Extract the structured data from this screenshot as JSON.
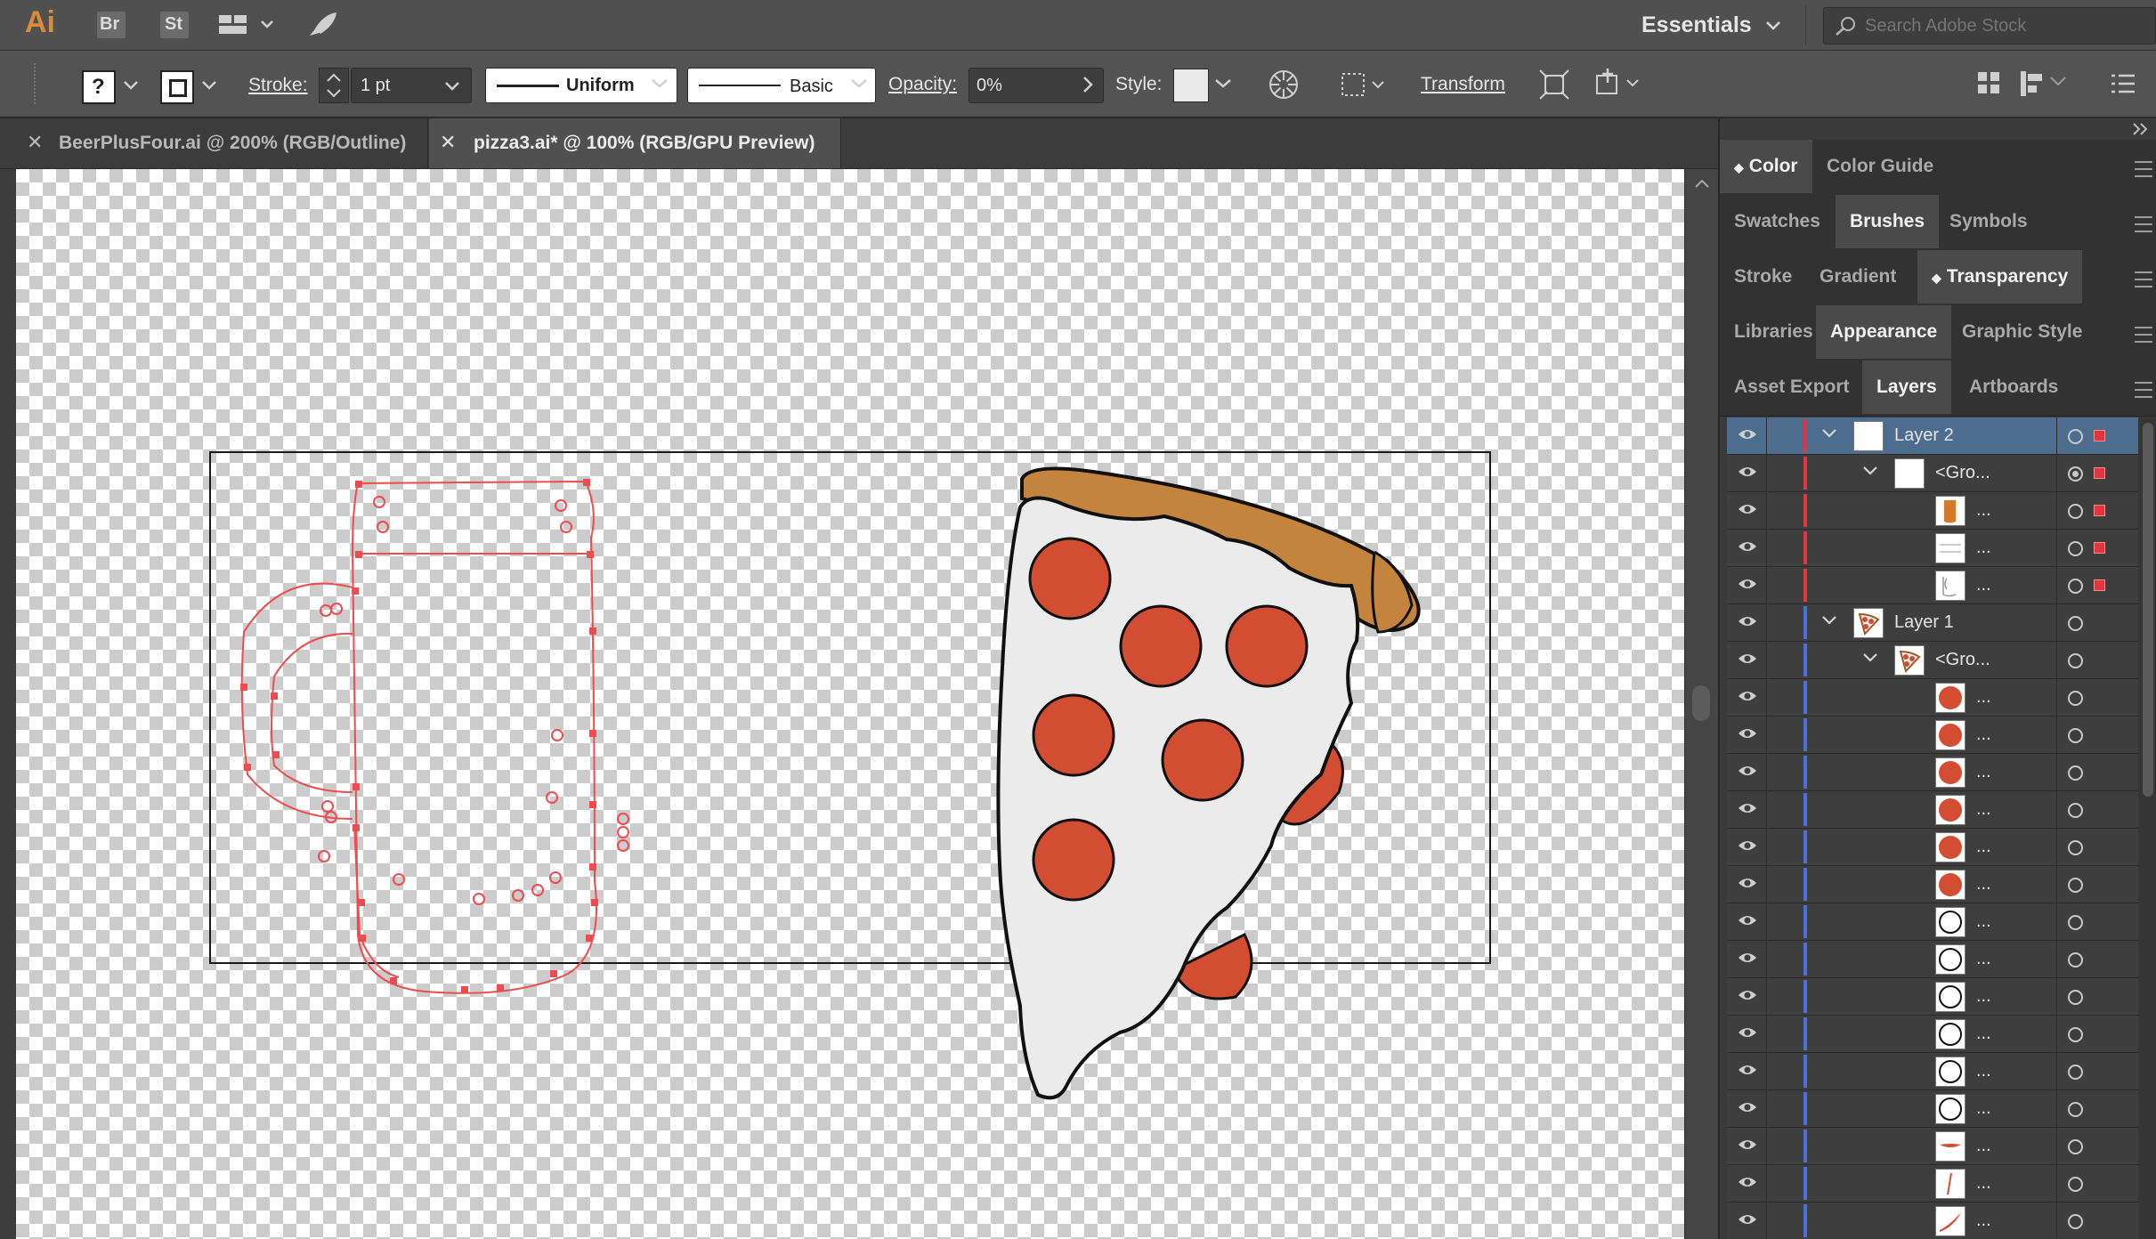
{
  "app": {
    "logo": "Ai",
    "bridge_button": "Br",
    "stock_button": "St",
    "workspace": "Essentials",
    "search_placeholder": "Search Adobe Stock"
  },
  "control_bar": {
    "fill_state": "?",
    "stroke_label": "Stroke:",
    "stroke_weight": "1 pt",
    "profile_label": "Uniform",
    "brush_label": "Basic",
    "opacity_label": "Opacity:",
    "opacity_value": "0%",
    "style_label": "Style:",
    "transform_label": "Transform"
  },
  "tabs": [
    {
      "label": "BeerPlusFour.ai @ 200% (RGB/Outline)",
      "active": false
    },
    {
      "label": "pizza3.ai* @ 100% (RGB/GPU Preview)",
      "active": true
    }
  ],
  "panels": {
    "group1": [
      "Color",
      "Color Guide"
    ],
    "group2": [
      "Swatches",
      "Brushes",
      "Symbols"
    ],
    "group3": [
      "Stroke",
      "Gradient",
      "Transparency"
    ],
    "group4": [
      "Libraries",
      "Appearance",
      "Graphic Style"
    ],
    "group5": [
      "Asset Export",
      "Layers",
      "Artboards"
    ]
  },
  "layers": [
    {
      "name": "Layer 2",
      "thumb": "white",
      "color": "#e0363f",
      "selected": true
    },
    {
      "name": "<Gro...",
      "thumb": "white",
      "color": "#e0363f"
    },
    {
      "name": "...",
      "thumb": "orange",
      "color": "#e0363f"
    },
    {
      "name": "...",
      "thumb": "lines",
      "color": "#e0363f"
    },
    {
      "name": "...",
      "thumb": "mug",
      "color": "#e0363f"
    },
    {
      "name": "Layer 1",
      "thumb": "pizza",
      "color": "#4d6fd8"
    },
    {
      "name": "<Gro...",
      "thumb": "pizza",
      "color": "#4d6fd8"
    },
    {
      "name": "...",
      "thumb": "pepperoni",
      "color": "#4d6fd8"
    },
    {
      "name": "...",
      "thumb": "pepperoni",
      "color": "#4d6fd8"
    },
    {
      "name": "...",
      "thumb": "pepperoni",
      "color": "#4d6fd8"
    },
    {
      "name": "...",
      "thumb": "pepperoni",
      "color": "#4d6fd8"
    },
    {
      "name": "...",
      "thumb": "pepperoni",
      "color": "#4d6fd8"
    },
    {
      "name": "...",
      "thumb": "pepperoni",
      "color": "#4d6fd8"
    },
    {
      "name": "...",
      "thumb": "circle",
      "color": "#4d6fd8"
    },
    {
      "name": "...",
      "thumb": "circle",
      "color": "#4d6fd8"
    },
    {
      "name": "...",
      "thumb": "circle",
      "color": "#4d6fd8"
    },
    {
      "name": "...",
      "thumb": "circle",
      "color": "#4d6fd8"
    },
    {
      "name": "...",
      "thumb": "circle",
      "color": "#4d6fd8"
    },
    {
      "name": "...",
      "thumb": "circle",
      "color": "#4d6fd8"
    },
    {
      "name": "...",
      "thumb": "drip",
      "color": "#4d6fd8"
    },
    {
      "name": "...",
      "thumb": "slash",
      "color": "#4d6fd8"
    },
    {
      "name": "...",
      "thumb": "curve",
      "color": "#4d6fd8"
    }
  ],
  "colors": {
    "ui_bg": "#3c3c3c",
    "layer_select": "#4d6d8e",
    "pepperoni": "#d24d32",
    "crust": "#c4843e",
    "cheese": "#ececec",
    "outline_path": "#ee4c4f"
  }
}
